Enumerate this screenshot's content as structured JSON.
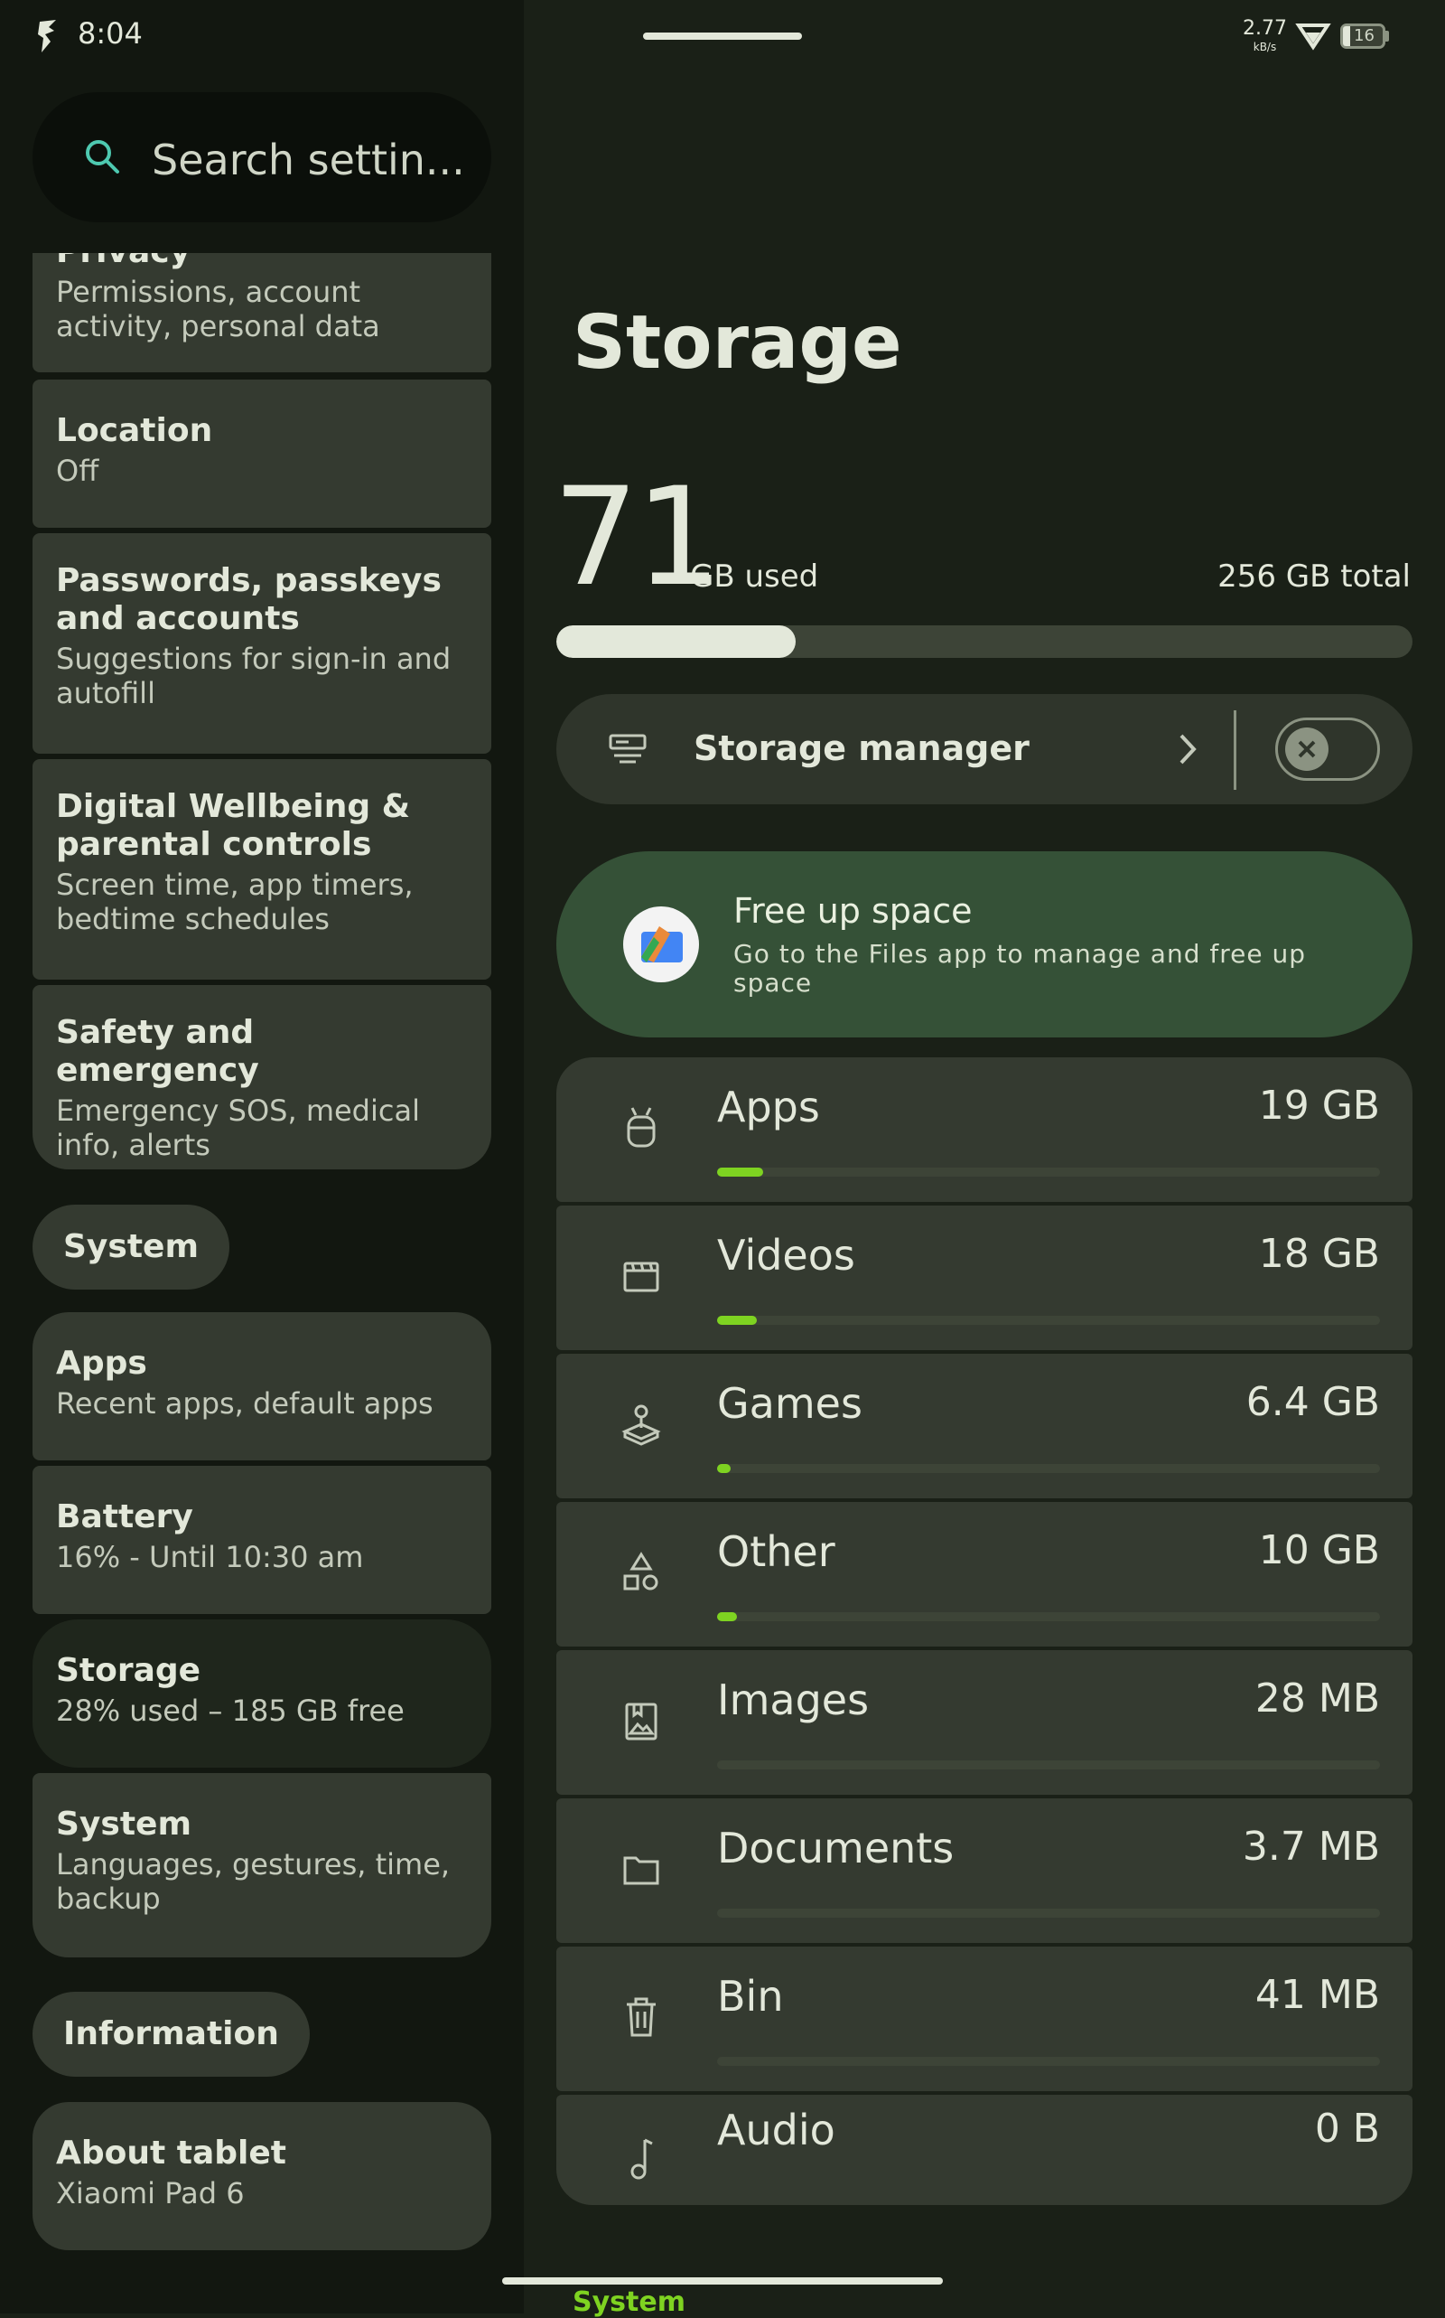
{
  "status_bar": {
    "time": "8:04",
    "net_speed": "2.77",
    "net_unit": "kB/s",
    "battery": "16"
  },
  "search": {
    "placeholder": "Search settin..."
  },
  "sidebar": {
    "items": [
      {
        "title": "Privacy",
        "subtitle": "Permissions, account activity, personal data"
      },
      {
        "title": "Location",
        "subtitle": "Off"
      },
      {
        "title": "Passwords, passkeys and accounts",
        "subtitle": "Suggestions for sign-in and autofill"
      },
      {
        "title": "Digital Wellbeing & parental controls",
        "subtitle": "Screen time, app timers, bedtime schedules"
      },
      {
        "title": "Safety and emergency",
        "subtitle": "Emergency SOS, medical info, alerts"
      }
    ],
    "section_system": "System",
    "system_items": [
      {
        "title": "Apps",
        "subtitle": "Recent apps, default apps"
      },
      {
        "title": "Battery",
        "subtitle": "16% - Until 10:30 am"
      },
      {
        "title": "Storage",
        "subtitle": "28% used – 185 GB free"
      },
      {
        "title": "System",
        "subtitle": "Languages, gestures, time, backup"
      }
    ],
    "section_information": "Information",
    "info_items": [
      {
        "title": "About tablet",
        "subtitle": "Xiaomi Pad 6"
      }
    ]
  },
  "storage": {
    "title": "Storage",
    "used_value": "71",
    "used_label": "GB used",
    "total_label": "256 GB total",
    "used_fraction": 0.28,
    "manager_label": "Storage manager",
    "manager_enabled": false,
    "free_up": {
      "title": "Free up space",
      "description": "Go to the Files app to manage and free up space"
    },
    "categories": [
      {
        "name": "Apps",
        "size": "19 GB",
        "fraction": 0.07,
        "icon": "android-icon"
      },
      {
        "name": "Videos",
        "size": "18 GB",
        "fraction": 0.06,
        "icon": "movie-icon"
      },
      {
        "name": "Games",
        "size": "6.4 GB",
        "fraction": 0.02,
        "icon": "joystick-icon"
      },
      {
        "name": "Other",
        "size": "10 GB",
        "fraction": 0.03,
        "icon": "shapes-icon"
      },
      {
        "name": "Images",
        "size": "28 MB",
        "fraction": 0.0,
        "icon": "image-icon"
      },
      {
        "name": "Documents",
        "size": "3.7 MB",
        "fraction": 0.0,
        "icon": "folder-icon"
      },
      {
        "name": "Bin",
        "size": "41 MB",
        "fraction": 0.0,
        "icon": "trash-icon"
      },
      {
        "name": "Audio",
        "size": "0 B",
        "fraction": 0.0,
        "icon": "music-note-icon"
      }
    ],
    "bottom_peek": "System"
  },
  "colors": {
    "accent_green": "#7ed321",
    "free_up_card": "#355137",
    "card": "#343a30",
    "background": "#1a2017"
  }
}
